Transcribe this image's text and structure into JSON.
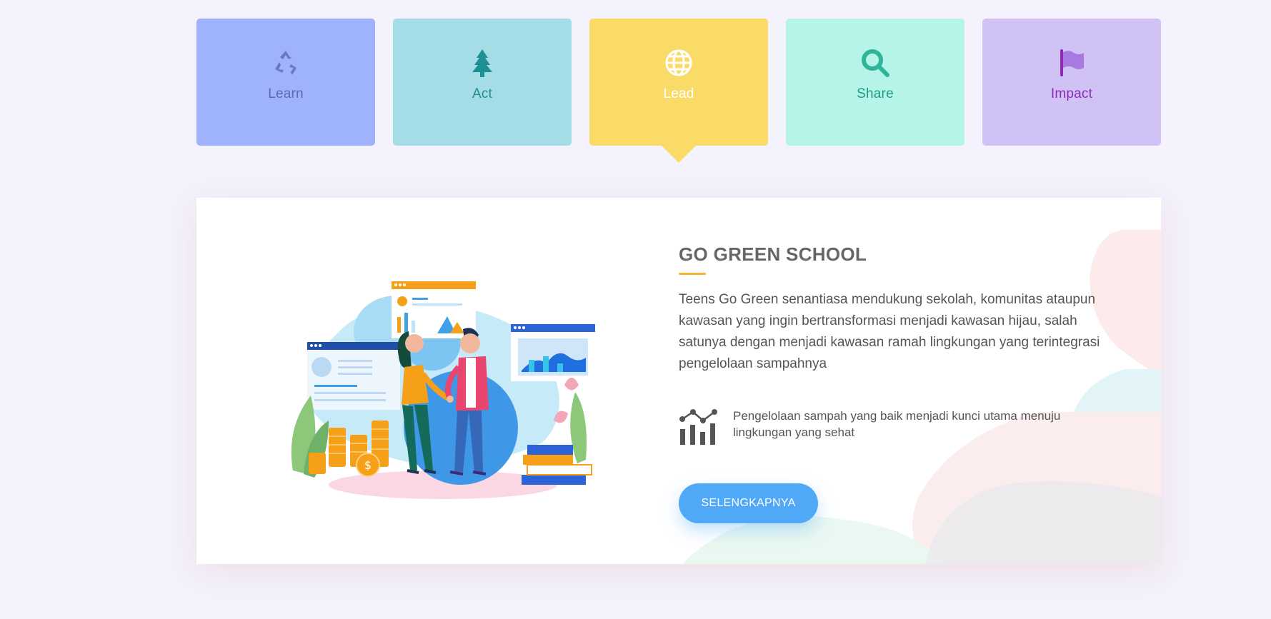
{
  "tabs": [
    {
      "label": "Learn",
      "icon": "recycle-icon",
      "bg": "#9fb2fc",
      "color": "#5b67b8",
      "active": false
    },
    {
      "label": "Act",
      "icon": "tree-icon",
      "bg": "#a4dde6",
      "color": "#1e8f93",
      "active": false
    },
    {
      "label": "Lead",
      "icon": "globe-icon",
      "bg": "#fadb68",
      "color": "#ffffff",
      "active": true
    },
    {
      "label": "Share",
      "icon": "magnifier-icon",
      "bg": "#b6f4e9",
      "color": "#1f9a80",
      "active": false
    },
    {
      "label": "Impact",
      "icon": "flag-icon",
      "bg": "#d1c2f5",
      "color": "#8d2ab8",
      "active": false
    }
  ],
  "section": {
    "title": "GO GREEN SCHOOL",
    "description": "Teens Go Green senantiasa mendukung sekolah, komunitas ataupun kawasan yang ingin bertransformasi menjadi kawasan hijau, salah satunya dengan menjadi kawasan ramah lingkungan yang terintegrasi pengelolaan sampahnya",
    "feature_icon": "chart-icon",
    "feature_text": "Pengelolaan sampah yang baik menjadi kunci utama menuju lingkungan yang sehat",
    "button_label": "SELENGKAPNYA",
    "illustration": "business-handshake-illustration"
  },
  "colors": {
    "page_bg": "#f3f2fd",
    "accent_underline": "#f8b42d",
    "button": "#4fa9f7"
  }
}
